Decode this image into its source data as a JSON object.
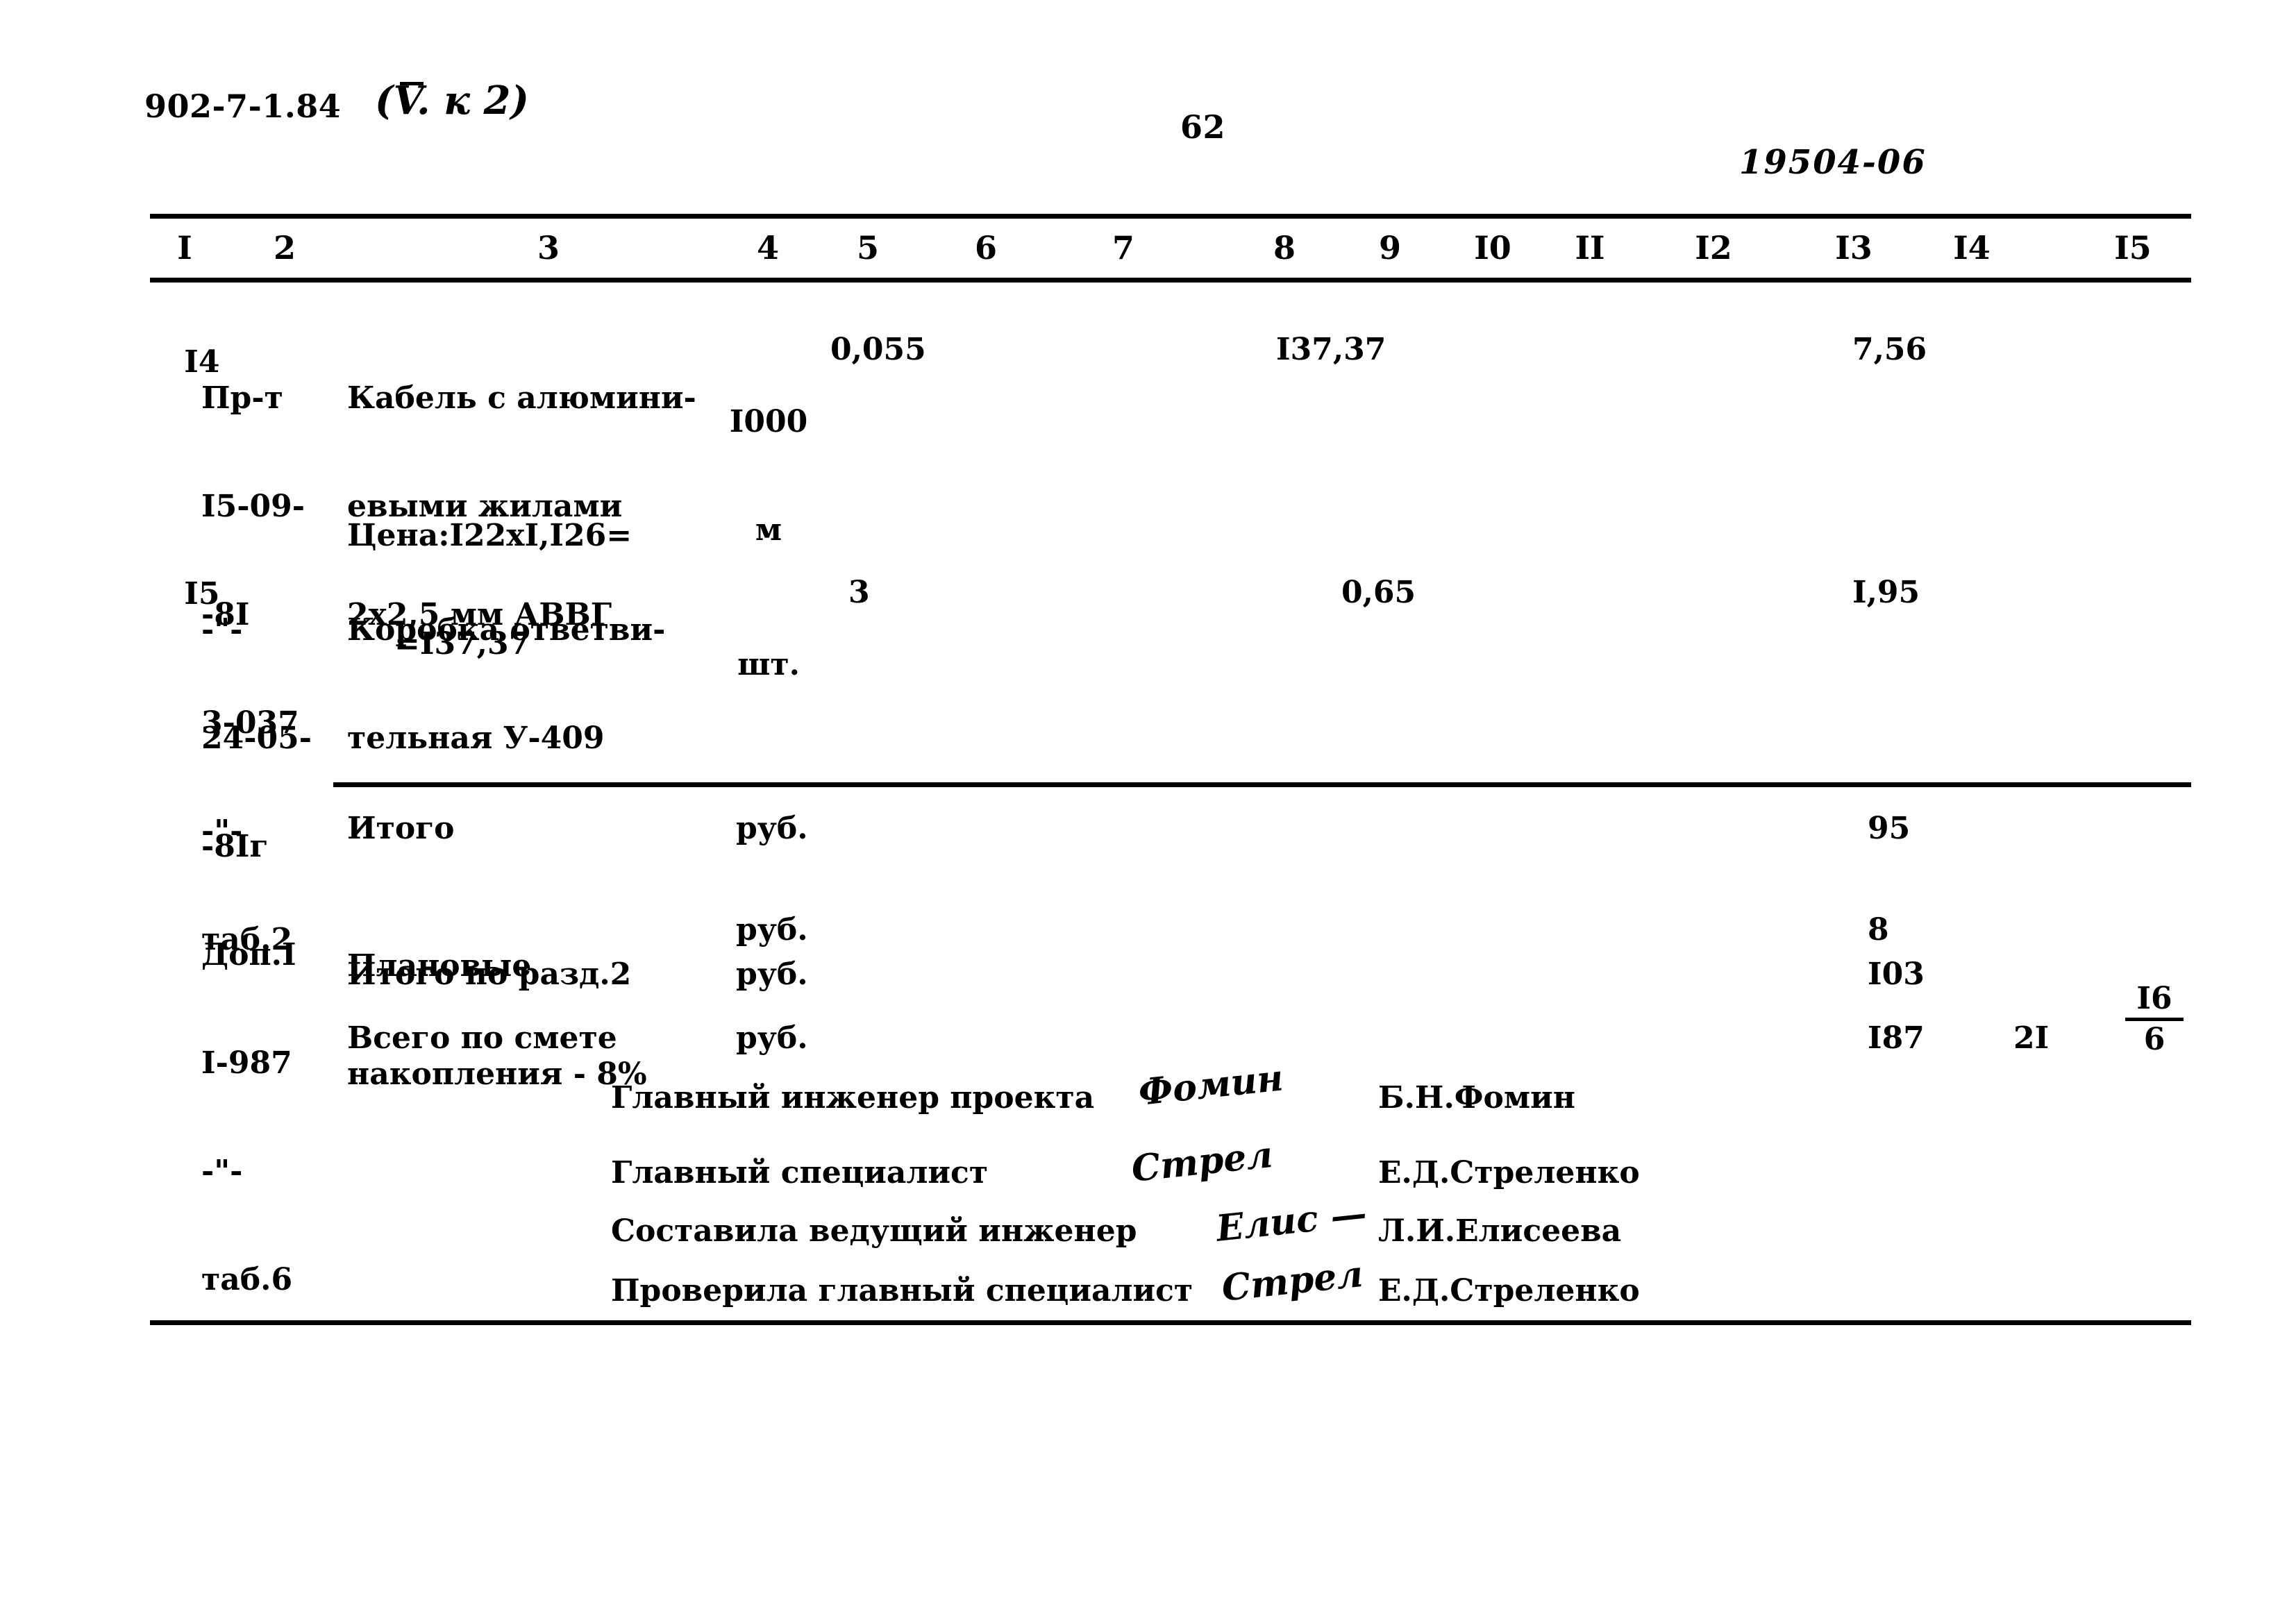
{
  "header": {
    "doc_code": "902-7-1.84",
    "doc_code_annotation": "(V. к 2)",
    "page_number": "62",
    "stamp": "19504-06"
  },
  "table": {
    "column_headers": [
      "I",
      "2",
      "3",
      "4",
      "5",
      "6",
      "7",
      "8",
      "9",
      "I0",
      "II",
      "I2",
      "I3",
      "I4",
      "I5"
    ],
    "rows": [
      {
        "no": "I4",
        "code_lines": [
          "Пр-т",
          "I5-09-",
          "-8I",
          "3-037",
          "-\"-",
          "таб.2"
        ],
        "description_lines": [
          "Кабель с алюмини-",
          "евыми жилами",
          "2х2,5 мм АВВГ"
        ],
        "description_note_lines": [
          "Цена:I22хI,I26=",
          "=I37,37"
        ],
        "unit_lines": [
          "I000",
          "м"
        ],
        "qty": "0,055",
        "col6": "",
        "col7": "",
        "col8": "I37,37",
        "col9": "",
        "col10": "",
        "col11": "",
        "col12": "",
        "col13": "7,56",
        "col14": "",
        "col15": ""
      },
      {
        "no": "I5",
        "code_lines": [
          "-\"-",
          "24-05-",
          "-8Iг",
          "Доп.I",
          "I-987",
          "-\"-",
          "таб.6"
        ],
        "description_lines": [
          "Коробка ответви-",
          "тельная У-409"
        ],
        "description_note_lines": [],
        "unit_lines": [
          "шт."
        ],
        "qty": "3",
        "col6": "",
        "col7": "",
        "col8": "",
        "col9": "0,65",
        "col10": "",
        "col11": "",
        "col12": "",
        "col13": "I,95",
        "col14": "",
        "col15": ""
      }
    ],
    "totals": [
      {
        "label_lines": [
          "Итого"
        ],
        "unit": "руб.",
        "col13": "95",
        "col14": "",
        "col15_numerator": "",
        "col15_denominator": ""
      },
      {
        "label_lines": [
          "Плановые",
          "накопления - 8%"
        ],
        "unit": "руб.",
        "col13": "8",
        "col14": "",
        "col15_numerator": "",
        "col15_denominator": ""
      },
      {
        "label_lines": [
          "Итого по разд.2"
        ],
        "unit": "руб.",
        "col13": "I03",
        "col14": "",
        "col15_numerator": "",
        "col15_denominator": ""
      },
      {
        "label_lines": [
          "Всего по смете"
        ],
        "unit": "руб.",
        "col13": "I87",
        "col14": "2I",
        "col15_numerator": "I6",
        "col15_denominator": "6"
      }
    ]
  },
  "signatures": [
    {
      "role": "Главный инженер проекта",
      "mark": "Фомин",
      "name": "Б.Н.Фомин"
    },
    {
      "role": "Главный специалист",
      "mark": "Стрел",
      "name": "Е.Д.Стреленко"
    },
    {
      "role": "Составила ведущий инженер",
      "mark": "Елис —",
      "name": "Л.И.Елисеева"
    },
    {
      "role": "Проверила главный специалист",
      "mark": "Стрел",
      "name": "Е.Д.Стреленко"
    }
  ]
}
